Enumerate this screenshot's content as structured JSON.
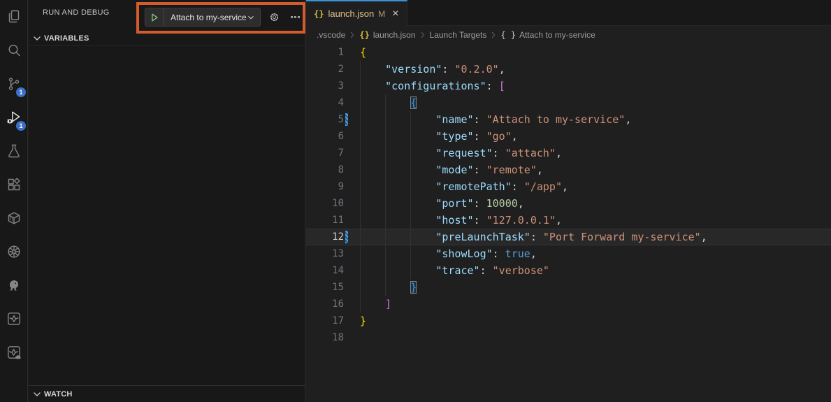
{
  "colors": {
    "annotation_orange": "#d25c2b",
    "tab_active_border": "#3d8fd6",
    "badge_blue": "#3b6fc9",
    "git_modified": "#e2c08d",
    "play_green": "#89d185",
    "sidebar_bg": "#181818",
    "editor_bg": "#1f1f1f"
  },
  "activity_bar": {
    "items": [
      {
        "icon": "explorer-icon",
        "label": "Explorer",
        "active": false,
        "badge": null
      },
      {
        "icon": "search-icon",
        "label": "Search",
        "active": false,
        "badge": null
      },
      {
        "icon": "source-control-icon",
        "label": "Source Control",
        "active": false,
        "badge": "1"
      },
      {
        "icon": "run-debug-icon",
        "label": "Run and Debug",
        "active": true,
        "badge": "1"
      },
      {
        "icon": "testing-icon",
        "label": "Testing",
        "active": false,
        "badge": null
      },
      {
        "icon": "extensions-icon",
        "label": "Extensions",
        "active": false,
        "badge": null
      },
      {
        "icon": "container-icon",
        "label": "Containers",
        "active": false,
        "badge": null
      },
      {
        "icon": "kubernetes-icon",
        "label": "Kubernetes",
        "active": false,
        "badge": null
      },
      {
        "icon": "postgres-icon",
        "label": "PostgreSQL",
        "active": false,
        "badge": null
      },
      {
        "icon": "cloud-code-icon",
        "label": "Cloud Code",
        "active": false,
        "badge": null
      },
      {
        "icon": "cloud-run-icon",
        "label": "Cloud Run",
        "active": false,
        "badge": null
      }
    ]
  },
  "sidebar": {
    "title": "RUN AND DEBUG",
    "toolbar": {
      "config_label": "Attach to my-service"
    },
    "variables_label": "VARIABLES",
    "watch_label": "WATCH"
  },
  "editor": {
    "tab": {
      "label": "launch.json",
      "modified_badge": "M",
      "close_glyph": "×"
    },
    "breadcrumb": [
      {
        "label": ".vscode"
      },
      {
        "icon": "braces-yellow",
        "label": "launch.json"
      },
      {
        "label": "Launch Targets"
      },
      {
        "icon": "braces-gray",
        "label": "Attach to my-service"
      }
    ],
    "code": {
      "lines": [
        {
          "n": 1,
          "g": [],
          "tokens": [
            [
              "b1",
              "{"
            ]
          ]
        },
        {
          "n": 2,
          "g": [
            0
          ],
          "tokens": [
            [
              "p",
              "    "
            ],
            [
              "k",
              "\"version\""
            ],
            [
              "p",
              ": "
            ],
            [
              "s",
              "\"0.2.0\""
            ],
            [
              "p",
              ","
            ]
          ]
        },
        {
          "n": 3,
          "g": [
            0
          ],
          "tokens": [
            [
              "p",
              "    "
            ],
            [
              "k",
              "\"configurations\""
            ],
            [
              "p",
              ": "
            ],
            [
              "b2",
              "["
            ]
          ]
        },
        {
          "n": 4,
          "g": [
            0,
            4
          ],
          "tokens": [
            [
              "p",
              "        "
            ],
            [
              "b3 m",
              "{"
            ]
          ]
        },
        {
          "n": 5,
          "g": [
            0,
            4,
            8
          ],
          "mod": true,
          "tokens": [
            [
              "p",
              "            "
            ],
            [
              "k",
              "\"name\""
            ],
            [
              "p",
              ": "
            ],
            [
              "s",
              "\"Attach to my-service\""
            ],
            [
              "p",
              ","
            ]
          ]
        },
        {
          "n": 6,
          "g": [
            0,
            4,
            8
          ],
          "tokens": [
            [
              "p",
              "            "
            ],
            [
              "k",
              "\"type\""
            ],
            [
              "p",
              ": "
            ],
            [
              "s",
              "\"go\""
            ],
            [
              "p",
              ","
            ]
          ]
        },
        {
          "n": 7,
          "g": [
            0,
            4,
            8
          ],
          "tokens": [
            [
              "p",
              "            "
            ],
            [
              "k",
              "\"request\""
            ],
            [
              "p",
              ": "
            ],
            [
              "s",
              "\"attach\""
            ],
            [
              "p",
              ","
            ]
          ]
        },
        {
          "n": 8,
          "g": [
            0,
            4,
            8
          ],
          "tokens": [
            [
              "p",
              "            "
            ],
            [
              "k",
              "\"mode\""
            ],
            [
              "p",
              ": "
            ],
            [
              "s",
              "\"remote\""
            ],
            [
              "p",
              ","
            ]
          ]
        },
        {
          "n": 9,
          "g": [
            0,
            4,
            8
          ],
          "tokens": [
            [
              "p",
              "            "
            ],
            [
              "k",
              "\"remotePath\""
            ],
            [
              "p",
              ": "
            ],
            [
              "s",
              "\"/app\""
            ],
            [
              "p",
              ","
            ]
          ]
        },
        {
          "n": 10,
          "g": [
            0,
            4,
            8
          ],
          "tokens": [
            [
              "p",
              "            "
            ],
            [
              "k",
              "\"port\""
            ],
            [
              "p",
              ": "
            ],
            [
              "n",
              "10000"
            ],
            [
              "p",
              ","
            ]
          ]
        },
        {
          "n": 11,
          "g": [
            0,
            4,
            8
          ],
          "tokens": [
            [
              "p",
              "            "
            ],
            [
              "k",
              "\"host\""
            ],
            [
              "p",
              ": "
            ],
            [
              "s",
              "\"127.0.0.1\""
            ],
            [
              "p",
              ","
            ]
          ]
        },
        {
          "n": 12,
          "g": [
            0,
            4,
            8
          ],
          "mod": true,
          "cur": true,
          "tokens": [
            [
              "p",
              "            "
            ],
            [
              "k",
              "\"preLaunchTask\""
            ],
            [
              "p",
              ": "
            ],
            [
              "s",
              "\"Port Forward my-service\""
            ],
            [
              "p",
              ","
            ]
          ]
        },
        {
          "n": 13,
          "g": [
            0,
            4,
            8
          ],
          "tokens": [
            [
              "p",
              "            "
            ],
            [
              "k",
              "\"showLog\""
            ],
            [
              "p",
              ": "
            ],
            [
              "kw",
              "true"
            ],
            [
              "p",
              ","
            ]
          ]
        },
        {
          "n": 14,
          "g": [
            0,
            4,
            8
          ],
          "tokens": [
            [
              "p",
              "            "
            ],
            [
              "k",
              "\"trace\""
            ],
            [
              "p",
              ": "
            ],
            [
              "s",
              "\"verbose\""
            ]
          ]
        },
        {
          "n": 15,
          "g": [
            0,
            4
          ],
          "tokens": [
            [
              "p",
              "        "
            ],
            [
              "b3 m",
              "}"
            ]
          ]
        },
        {
          "n": 16,
          "g": [
            0
          ],
          "tokens": [
            [
              "p",
              "    "
            ],
            [
              "b2",
              "]"
            ]
          ]
        },
        {
          "n": 17,
          "g": [],
          "tokens": [
            [
              "b1",
              "}"
            ]
          ]
        },
        {
          "n": 18,
          "g": [],
          "tokens": []
        }
      ]
    }
  }
}
